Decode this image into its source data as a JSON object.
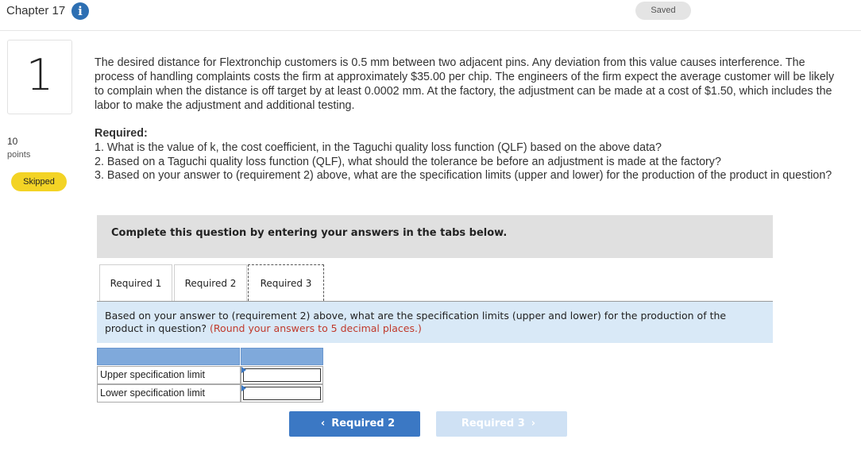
{
  "header": {
    "chapter": "Chapter 17",
    "info_icon": "i",
    "saved": "Saved"
  },
  "question": {
    "number": "1",
    "points_value": "10",
    "points_label": "points",
    "status": "Skipped",
    "text": "The desired distance for Flextronchip customers is 0.5 mm between two adjacent pins. Any deviation from this value causes interference. The process of handling complaints costs the firm at approximately $35.00 per chip. The engineers of the firm expect the average customer will be likely to complain when the distance is off target by at least 0.0002 mm. At the factory, the adjustment can be made at a cost of $1.50, which includes the labor to make the adjustment and additional testing.",
    "required_heading": "Required:",
    "requirements": [
      "1. What is the value of k, the cost coefficient, in the Taguchi quality loss function (QLF) based on the above data?",
      "2. Based on a Taguchi quality loss function (QLF), what should the tolerance be before an adjustment is made at the factory?",
      "3. Based on your answer to (requirement 2) above, what are the specification limits (upper and lower) for the production of the product in question?"
    ]
  },
  "panel": {
    "instruction": "Complete this question by entering your answers in the tabs below."
  },
  "tabs": [
    "Required 1",
    "Required 2",
    "Required 3"
  ],
  "active_tab": "Required 3",
  "instructions": {
    "text": "Based on your answer to (requirement 2) above, what are the specification limits (upper and lower) for the production of the product in question?",
    "note": "(Round your answers to 5 decimal places.)"
  },
  "table": {
    "rows": [
      {
        "label": "Upper specification limit",
        "value": ""
      },
      {
        "label": "Lower specification limit",
        "value": ""
      }
    ]
  },
  "nav": {
    "prev_label": "Required 2",
    "next_label": "Required 3",
    "prev_icon": "chevron-left-icon",
    "next_icon": "chevron-right-icon"
  },
  "colors": {
    "accent": "#3b78c4",
    "skipped_badge": "#f3d325",
    "table_header": "#7fa9db",
    "instruction_bg": "#d9e9f7",
    "note_red": "#c0392b"
  }
}
